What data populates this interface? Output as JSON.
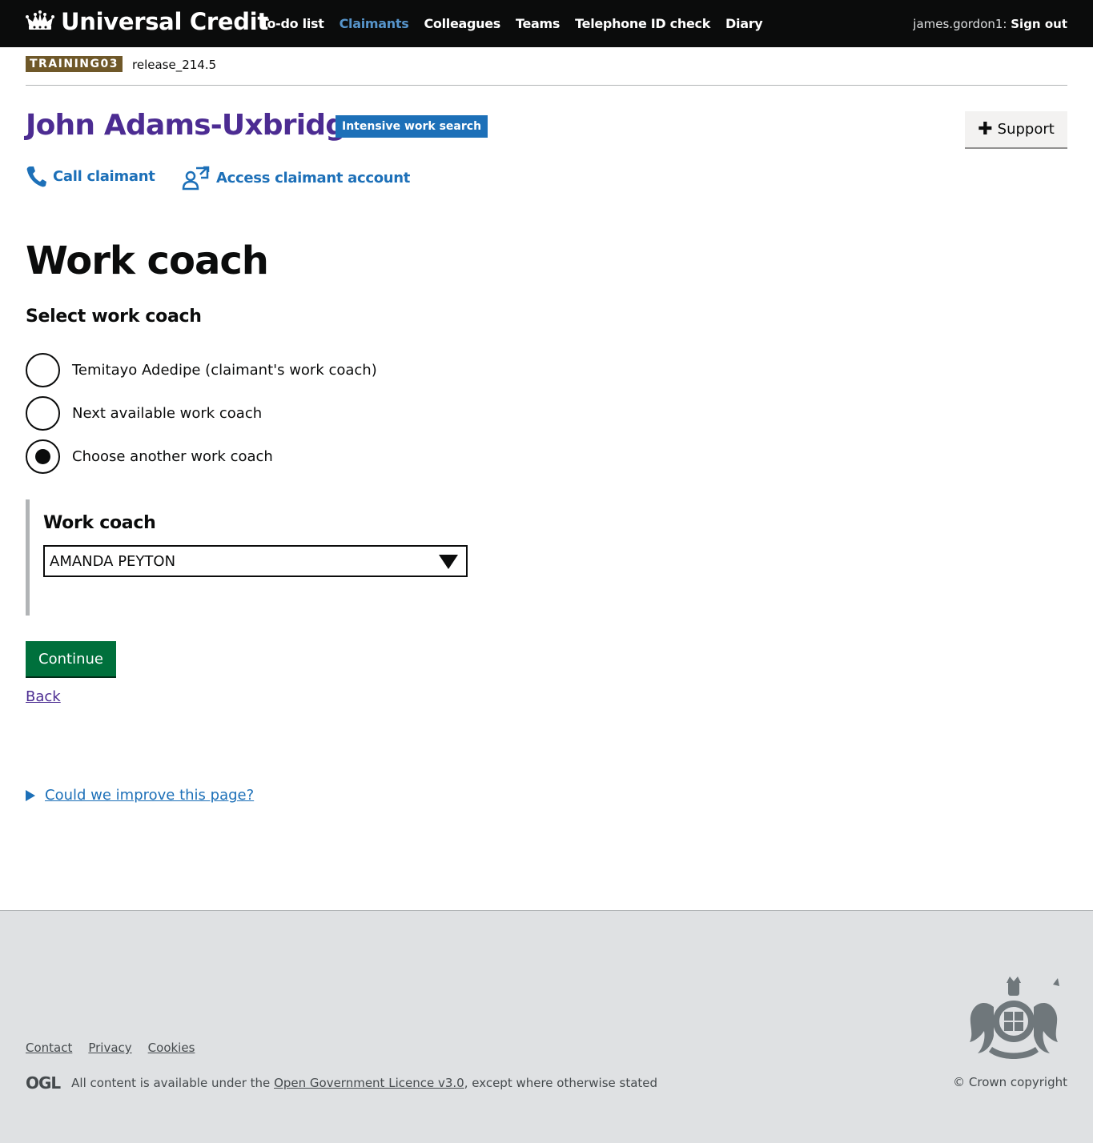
{
  "header": {
    "title": "Universal Credit",
    "nav": [
      "To-do list",
      "Claimants",
      "Colleagues",
      "Teams",
      "Telephone ID check",
      "Diary"
    ],
    "active_nav": "Claimants",
    "username": "james.gordon1:",
    "sign_out": "Sign out"
  },
  "phase": {
    "environment": "TRAINING03",
    "release": "release_214.5"
  },
  "claimant": {
    "name": "John Adams-Uxbridge",
    "regime": "Intensive work search",
    "support_button": "Support",
    "call_link": "Call claimant",
    "account_link": "Access claimant account"
  },
  "main": {
    "title": "Work coach",
    "legend": "Select work coach",
    "options": [
      {
        "label": "Temitayo Adedipe (claimant's work coach)",
        "checked": false
      },
      {
        "label": "Next available work coach",
        "checked": false
      },
      {
        "label": "Choose another work coach",
        "checked": true
      }
    ],
    "work_coach_label": "Work coach",
    "work_coach_value": "AMANDA PEYTON",
    "continue": "Continue",
    "back": "Back",
    "improve": "Could we improve this page?"
  },
  "footer": {
    "links": [
      "Contact",
      "Privacy",
      "Cookies"
    ],
    "ogl": "OGL",
    "licence_prefix": "All content is available under the",
    "licence_link": "Open Government Licence v3.0",
    "licence_suffix": ", except where otherwise stated",
    "copyright": "© Crown copyright"
  },
  "colors": {
    "header_bg": "#0b0c0c",
    "link_blue": "#1d70b8",
    "claimant_purple": "#4c2c92",
    "continue_green": "#00703c",
    "environment_tag": "#6f5829",
    "footer_bg": "#dfe1e3"
  },
  "icons": [
    "crown-icon",
    "phone-icon",
    "account-access-icon",
    "plus-icon",
    "dropdown-arrow-icon",
    "disclosure-triangle-icon",
    "royal-coat-of-arms"
  ]
}
